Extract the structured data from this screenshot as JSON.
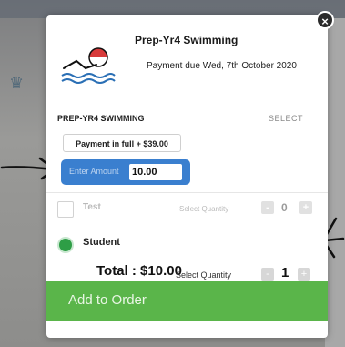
{
  "modal": {
    "title": "Prep-Yr4 Swimming",
    "payment_due": "Payment due Wed, 7th October 2020",
    "close_glyph": "×"
  },
  "event": {
    "name": "PREP-YR4 SWIMMING",
    "select_label": "SELECT"
  },
  "payment": {
    "option": "Payment in full + $39.00",
    "amount_placeholder": "Enter Amount",
    "amount_value": "10.00"
  },
  "tickets": [
    {
      "label": "Test",
      "qty_label": "Select Quantity",
      "minus": "-",
      "qty": "0",
      "plus": "+",
      "selected": false
    },
    {
      "label": "Student",
      "selected": true
    }
  ],
  "total": {
    "text": "Total : $10.00",
    "qty_label": "Select Quantity",
    "minus": "-",
    "qty": "1",
    "plus": "+"
  },
  "actions": {
    "add_to_order": "Add to Order"
  },
  "colors": {
    "accent_blue": "#3a7fcf",
    "accent_green": "#5ab54a",
    "selected_green": "#2e9e46"
  },
  "icons": {
    "close": "close-icon",
    "logo": "swimmer-logo-icon",
    "annotation_left": "hand-drawn-arrow-right-icon",
    "annotation_right": "hand-drawn-arrow-left-icon"
  }
}
